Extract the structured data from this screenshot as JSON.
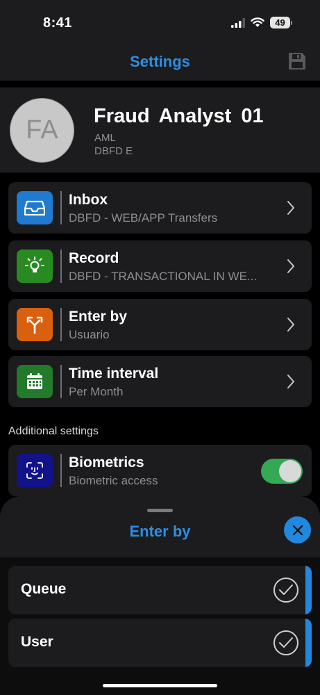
{
  "status_bar": {
    "time": "8:41",
    "battery": "49"
  },
  "header": {
    "title": "Settings",
    "save_icon": "floppy-disk-icon"
  },
  "profile": {
    "initials": "FA",
    "name": "Fraud  Analyst 01",
    "role": "AML",
    "unit": "DBFD E"
  },
  "menu": [
    {
      "title": "Inbox",
      "subtitle": "DBFD - WEB/APP Transfers",
      "icon": "inbox-tray-icon",
      "color": "#1f7ad0"
    },
    {
      "title": "Record",
      "subtitle": "DBFD - TRANSACTIONAL IN WE...",
      "icon": "lightbulb-icon",
      "color": "#2a8a22"
    },
    {
      "title": "Enter by",
      "subtitle": "Usuario",
      "icon": "fork-arrows-icon",
      "color": "#d8600e"
    },
    {
      "title": "Time interval",
      "subtitle": "Per Month",
      "icon": "calendar-icon",
      "color": "#227a2a"
    }
  ],
  "additional": {
    "label": "Additional settings",
    "biometrics": {
      "title": "Biometrics",
      "subtitle": "Biometric access",
      "enabled": true,
      "icon": "face-id-icon",
      "color": "#12128a"
    }
  },
  "sheet": {
    "title": "Enter by",
    "options": [
      {
        "label": "Queue"
      },
      {
        "label": "User"
      }
    ]
  },
  "colors": {
    "accent": "#2e8ee3",
    "toggle_on": "#34a853"
  }
}
